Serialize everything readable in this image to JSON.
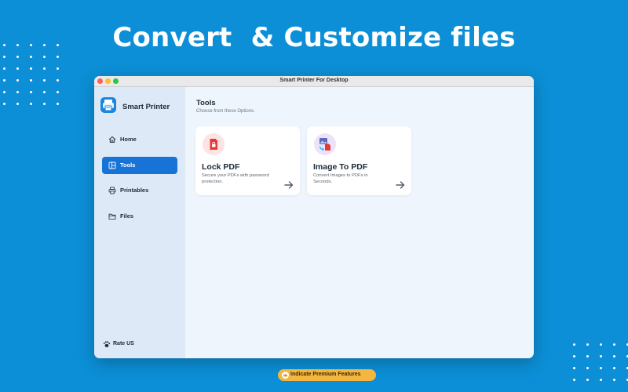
{
  "headline": "Convert  & Customize files",
  "window": {
    "title": "Smart Printer For Desktop"
  },
  "sidebar": {
    "brand": "Smart Printer",
    "items": [
      {
        "label": "Home",
        "icon": "home-icon",
        "active": false
      },
      {
        "label": "Tools",
        "icon": "tools-icon",
        "active": true
      },
      {
        "label": "Printables",
        "icon": "printables-icon",
        "active": false
      },
      {
        "label": "Files",
        "icon": "folder-icon",
        "active": false
      }
    ],
    "rate_label": "Rate US"
  },
  "main": {
    "title": "Tools",
    "subtitle": "Choose from these Options.",
    "cards": [
      {
        "title": "Lock PDF",
        "description": "Secure your PDFs with password protection.",
        "icon": "lock-pdf-icon"
      },
      {
        "title": "Image To PDF",
        "description": "Convert Images to PDFs in Seconds.",
        "icon": "image-to-pdf-icon"
      }
    ]
  },
  "premium_badge": "Indicate Premium Features",
  "colors": {
    "background": "#0c8fd6",
    "accent": "#1873d6",
    "premium": "#f5b640",
    "lock_red": "#e53935"
  }
}
